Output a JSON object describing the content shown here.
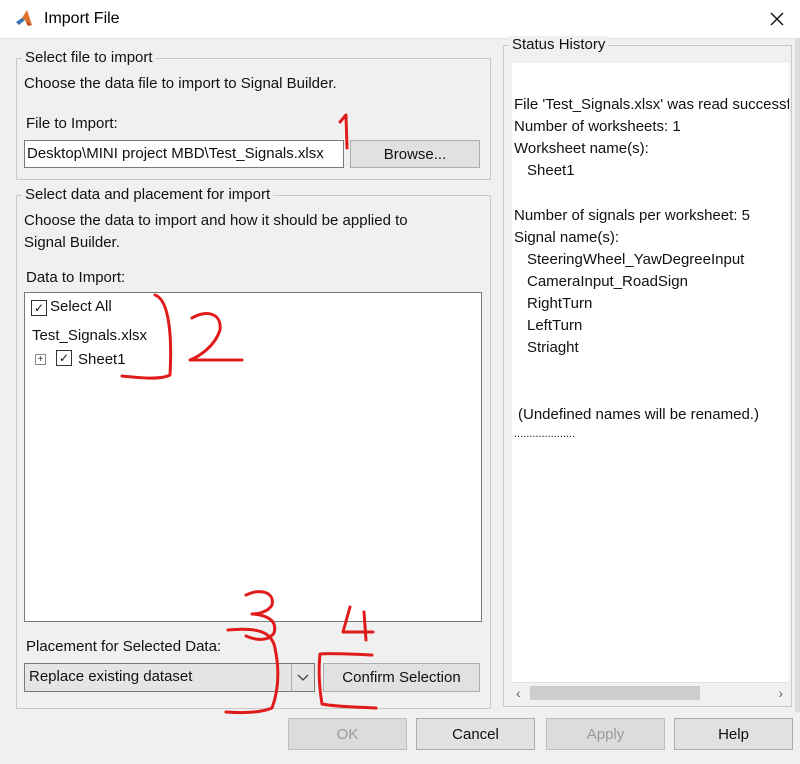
{
  "window": {
    "title": "Import File"
  },
  "select_file": {
    "group_title": "Select file to import",
    "description": "Choose the data file to import to Signal Builder.",
    "file_label": "File to Import:",
    "file_value": "Desktop\\MINI project MBD\\Test_Signals.xlsx",
    "browse_label": "Browse..."
  },
  "select_data": {
    "group_title": "Select data and placement for import",
    "description_line1": "Choose the data to import and how it should be applied to",
    "description_line2": "Signal Builder.",
    "data_label": "Data to Import:",
    "select_all_label": "Select All",
    "file_node_label": "Test_Signals.xlsx",
    "sheet_label": "Sheet1"
  },
  "placement": {
    "label": "Placement for Selected Data:",
    "selected_option": "Replace existing dataset",
    "confirm_label": "Confirm Selection"
  },
  "status_history": {
    "title": "Status History",
    "line1": "File 'Test_Signals.xlsx' was read successfu",
    "line2": "Number of worksheets: 1",
    "line3": "Worksheet name(s):",
    "line4": "Sheet1",
    "line5": "Number of signals per worksheet: 5",
    "line6": "Signal name(s):",
    "signals": [
      "SteeringWheel_YawDegreeInput",
      "CameraInput_RoadSign",
      "RightTurn",
      "LeftTurn",
      "Striaght"
    ],
    "note": "(Undefined names will be renamed.)",
    "dots": "...................."
  },
  "buttons": {
    "ok": "OK",
    "cancel": "Cancel",
    "apply": "Apply",
    "help": "Help"
  },
  "annotations": {
    "n1": "1",
    "n2": "2",
    "n3": "3",
    "n4": "4",
    "color": "#e01b1b"
  },
  "colors": {
    "dialog_bg": "#f0f0f0",
    "disabled_text": "#9a9a9a"
  }
}
